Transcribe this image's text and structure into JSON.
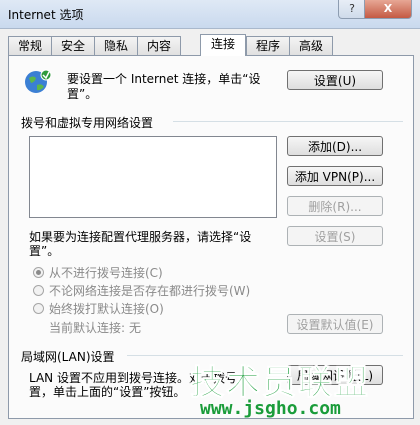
{
  "window": {
    "title": "Internet 选项",
    "help_label": "?",
    "close_label": "X"
  },
  "tabs": [
    {
      "label": "常规"
    },
    {
      "label": "安全"
    },
    {
      "label": "隐私"
    },
    {
      "label": "内容"
    },
    {
      "label": "连接",
      "active": true
    },
    {
      "label": "程序"
    },
    {
      "label": "高级"
    }
  ],
  "setup": {
    "text_line1": "要设置一个 Internet 连接，单击“设",
    "text_line2": "置”。",
    "button_label": "设置(U)"
  },
  "dialup": {
    "heading": "拨号和虚拟专用网络设置",
    "add_button": "添加(D)...",
    "add_vpn_button": "添加 VPN(P)...",
    "remove_button": "删除(R)...",
    "proxy_text_line1": "如果要为连接配置代理服务器，请选择“设",
    "proxy_text_line2": "置”。",
    "settings_button": "设置(S)",
    "options": [
      {
        "label": "从不进行拨号连接(C)",
        "checked": true
      },
      {
        "label": "不论网络连接是否存在都进行拨号(W)",
        "checked": false
      },
      {
        "label": "始终拨打默认连接(O)",
        "checked": false
      }
    ],
    "current_default_label": "当前默认连接:",
    "current_default_value": "无",
    "set_default_button": "设置默认值(E)"
  },
  "lan": {
    "heading": "局域网(LAN)设置",
    "text_line1": "LAN 设置不应用到拨号连接。对于拨号",
    "text_line2": "置，单击上面的“设置”按钮。",
    "button_label": "局域网设置(L)"
  },
  "watermark": {
    "main": "技术员联盟",
    "url": "www.jsgho.com"
  }
}
